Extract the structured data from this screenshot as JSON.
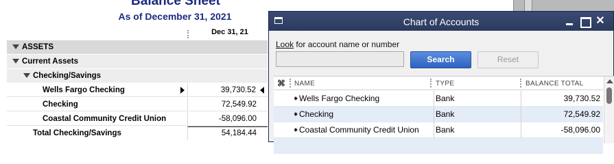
{
  "report": {
    "title": "Balance Sheet",
    "subtitle": "As of December 31, 2021",
    "column_header": "Dec 31, 21",
    "rows": [
      {
        "label": "ASSETS",
        "amount": ""
      },
      {
        "label": "Current Assets",
        "amount": ""
      },
      {
        "label": "Checking/Savings",
        "amount": ""
      },
      {
        "label": "Wells Fargo Checking",
        "amount": "39,730.52"
      },
      {
        "label": "Checking",
        "amount": "72,549.92"
      },
      {
        "label": "Coastal Community Credit Union",
        "amount": "-58,096.00"
      },
      {
        "label": "Total Checking/Savings",
        "amount": "54,184.44"
      }
    ]
  },
  "coa": {
    "title": "Chart of Accounts",
    "look_label_prefix": "Look",
    "look_label_rest": " for account name or number",
    "search_value": "",
    "search_button": "Search",
    "reset_button": "Reset",
    "columns": {
      "hash": "⌘",
      "name": "NAME",
      "type": "TYPE",
      "balance": "BALANCE TOTAL"
    },
    "accounts": [
      {
        "name": "Wells Fargo Checking",
        "type": "Bank",
        "balance": "39,730.52"
      },
      {
        "name": "Checking",
        "type": "Bank",
        "balance": "72,549.92"
      },
      {
        "name": "Coastal Community Credit Union",
        "type": "Bank",
        "balance": "-58,096.00"
      }
    ],
    "titlebar_buttons": {
      "close": "✕"
    }
  }
}
